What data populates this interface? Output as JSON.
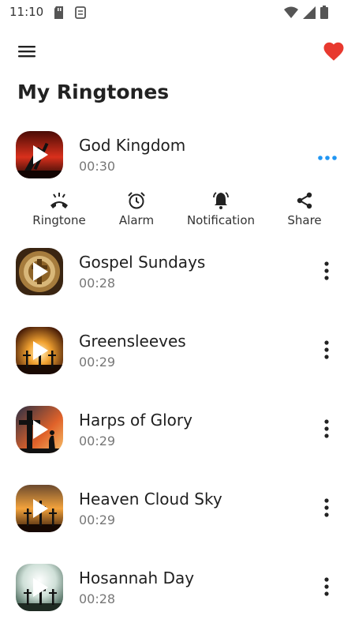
{
  "status": {
    "time": "11:10"
  },
  "app_bar": {
    "menu_icon": "hamburger-menu-icon",
    "favorite_icon": "heart-icon",
    "favorite_color": "#e8392f"
  },
  "page": {
    "title": "My Ringtones"
  },
  "actions": [
    {
      "label": "Ringtone",
      "icon": "phone-ringing-icon"
    },
    {
      "label": "Alarm",
      "icon": "alarm-clock-icon"
    },
    {
      "label": "Notification",
      "icon": "bell-icon"
    },
    {
      "label": "Share",
      "icon": "share-icon"
    }
  ],
  "tracks": [
    {
      "name": "God Kingdom",
      "duration": "00:30",
      "expanded": true
    },
    {
      "name": "Gospel Sundays",
      "duration": "00:28"
    },
    {
      "name": "Greensleeves",
      "duration": "00:29"
    },
    {
      "name": "Harps of Glory",
      "duration": "00:29"
    },
    {
      "name": "Heaven Cloud Sky",
      "duration": "00:29"
    },
    {
      "name": "Hosannah Day",
      "duration": "00:28"
    }
  ],
  "colors": {
    "accent": "#2196f3",
    "heart": "#e8392f"
  }
}
